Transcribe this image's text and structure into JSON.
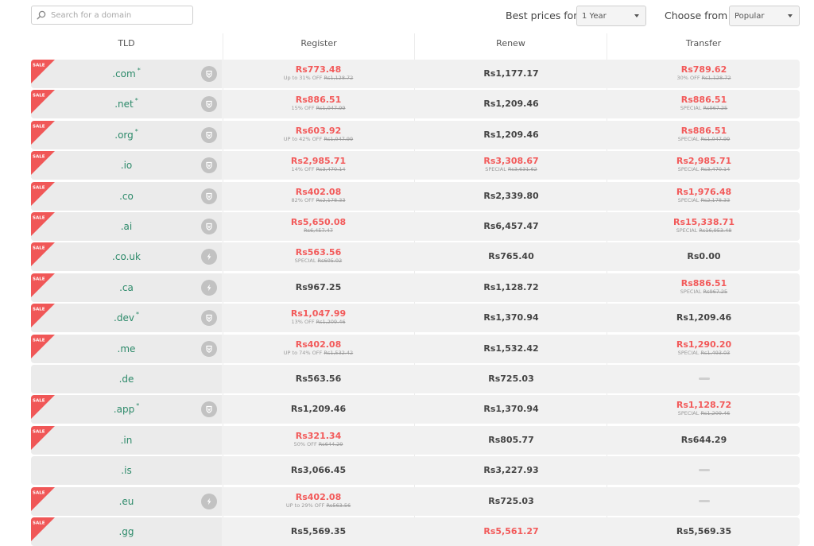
{
  "search": {
    "placeholder": "Search for a domain"
  },
  "filters": {
    "best_prices_label": "Best prices for",
    "period_value": "1 Year",
    "choose_from_label": "Choose from",
    "category_value": "Popular"
  },
  "columns": {
    "tld": "TLD",
    "register": "Register",
    "renew": "Renew",
    "transfer": "Transfer"
  },
  "sale_label": "SALE",
  "colors": {
    "sale_price": "#f25a5a",
    "tld_text": "#2d8a6a",
    "sale_badge": "#f05757"
  },
  "rows": [
    {
      "tld": ".com",
      "star": "*",
      "sale": true,
      "badge": "shield-icon",
      "register": {
        "price": "Rs773.48",
        "note": "Up to 31% OFF",
        "old": "Rs1,128.72",
        "red": true
      },
      "renew": {
        "price": "Rs1,177.17",
        "red": false
      },
      "transfer": {
        "price": "Rs789.62",
        "note": "30% OFF",
        "old": "Rs1,128.72",
        "red": true
      }
    },
    {
      "tld": ".net",
      "star": "*",
      "sale": true,
      "badge": "shield-icon",
      "register": {
        "price": "Rs886.51",
        "note": "15% OFF",
        "old": "Rs1,047.99",
        "red": true
      },
      "renew": {
        "price": "Rs1,209.46",
        "red": false
      },
      "transfer": {
        "price": "Rs886.51",
        "note": "SPECIAL",
        "old": "Rs967.25",
        "red": true
      }
    },
    {
      "tld": ".org",
      "star": "*",
      "sale": true,
      "badge": "shield-icon",
      "register": {
        "price": "Rs603.92",
        "note": "UP to 42% OFF",
        "old": "Rs1,047.99",
        "red": true
      },
      "renew": {
        "price": "Rs1,209.46",
        "red": false
      },
      "transfer": {
        "price": "Rs886.51",
        "note": "SPECIAL",
        "old": "Rs1,047.99",
        "red": true
      }
    },
    {
      "tld": ".io",
      "star": "",
      "sale": true,
      "badge": "shield-icon",
      "register": {
        "price": "Rs2,985.71",
        "note": "14% OFF",
        "old": "Rs3,470.14",
        "red": true
      },
      "renew": {
        "price": "Rs3,308.67",
        "note": "SPECIAL",
        "old": "Rs3,631.62",
        "red": true
      },
      "transfer": {
        "price": "Rs2,985.71",
        "note": "SPECIAL",
        "old": "Rs3,470.14",
        "red": true
      }
    },
    {
      "tld": ".co",
      "star": "",
      "sale": true,
      "badge": "shield-icon",
      "register": {
        "price": "Rs402.08",
        "note": "82% OFF",
        "old": "Rs2,178.33",
        "red": true
      },
      "renew": {
        "price": "Rs2,339.80",
        "red": false
      },
      "transfer": {
        "price": "Rs1,976.48",
        "note": "SPECIAL",
        "old": "Rs2,178.33",
        "red": true
      }
    },
    {
      "tld": ".ai",
      "star": "",
      "sale": true,
      "badge": "shield-icon",
      "register": {
        "price": "Rs5,650.08",
        "note": "",
        "old": "Rs6,457.47",
        "red": true
      },
      "renew": {
        "price": "Rs6,457.47",
        "red": false
      },
      "transfer": {
        "price": "Rs15,338.71",
        "note": "SPECIAL",
        "old": "Rs16,953.48",
        "red": true
      }
    },
    {
      "tld": ".co.uk",
      "star": "",
      "sale": true,
      "badge": "bolt-icon",
      "register": {
        "price": "Rs563.56",
        "note": "SPECIAL",
        "old": "Rs605.02",
        "red": true
      },
      "renew": {
        "price": "Rs765.40",
        "red": false
      },
      "transfer": {
        "price": "Rs0.00",
        "red": false
      }
    },
    {
      "tld": ".ca",
      "star": "",
      "sale": true,
      "badge": "bolt-icon",
      "register": {
        "price": "Rs967.25",
        "red": false
      },
      "renew": {
        "price": "Rs1,128.72",
        "red": false
      },
      "transfer": {
        "price": "Rs886.51",
        "note": "SPECIAL",
        "old": "Rs967.25",
        "red": true
      }
    },
    {
      "tld": ".dev",
      "star": "*",
      "sale": true,
      "badge": "shield-icon",
      "register": {
        "price": "Rs1,047.99",
        "note": "13% OFF",
        "old": "Rs1,209.46",
        "red": true
      },
      "renew": {
        "price": "Rs1,370.94",
        "red": false
      },
      "transfer": {
        "price": "Rs1,209.46",
        "red": false
      }
    },
    {
      "tld": ".me",
      "star": "",
      "sale": true,
      "badge": "shield-icon",
      "register": {
        "price": "Rs402.08",
        "note": "UP to 74% OFF",
        "old": "Rs1,532.42",
        "red": true
      },
      "renew": {
        "price": "Rs1,532.42",
        "red": false
      },
      "transfer": {
        "price": "Rs1,290.20",
        "note": "SPECIAL",
        "old": "Rs1,493.03",
        "red": true
      }
    },
    {
      "tld": ".de",
      "star": "",
      "sale": false,
      "badge": "",
      "register": {
        "price": "Rs563.56",
        "red": false
      },
      "renew": {
        "price": "Rs725.03",
        "red": false
      },
      "transfer": {
        "price": "",
        "red": false
      }
    },
    {
      "tld": ".app",
      "star": "*",
      "sale": true,
      "badge": "shield-icon",
      "register": {
        "price": "Rs1,209.46",
        "red": false
      },
      "renew": {
        "price": "Rs1,370.94",
        "red": false
      },
      "transfer": {
        "price": "Rs1,128.72",
        "note": "SPECIAL",
        "old": "Rs1,209.46",
        "red": true
      }
    },
    {
      "tld": ".in",
      "star": "",
      "sale": true,
      "badge": "",
      "register": {
        "price": "Rs321.34",
        "note": "50% OFF",
        "old": "Rs644.29",
        "red": true
      },
      "renew": {
        "price": "Rs805.77",
        "red": false
      },
      "transfer": {
        "price": "Rs644.29",
        "red": false
      }
    },
    {
      "tld": ".is",
      "star": "",
      "sale": false,
      "badge": "",
      "register": {
        "price": "Rs3,066.45",
        "red": false
      },
      "renew": {
        "price": "Rs3,227.93",
        "red": false
      },
      "transfer": {
        "price": "",
        "red": false
      }
    },
    {
      "tld": ".eu",
      "star": "",
      "sale": true,
      "badge": "bolt-icon",
      "register": {
        "price": "Rs402.08",
        "note": "UP to 29% OFF",
        "old": "Rs563.56",
        "red": true
      },
      "renew": {
        "price": "Rs725.03",
        "red": false
      },
      "transfer": {
        "price": "",
        "red": false
      }
    },
    {
      "tld": ".gg",
      "star": "",
      "sale": true,
      "badge": "",
      "register": {
        "price": "Rs5,569.35",
        "red": false
      },
      "renew": {
        "price": "Rs5,561.27",
        "red": true
      },
      "transfer": {
        "price": "Rs5,569.35",
        "red": false
      }
    }
  ]
}
